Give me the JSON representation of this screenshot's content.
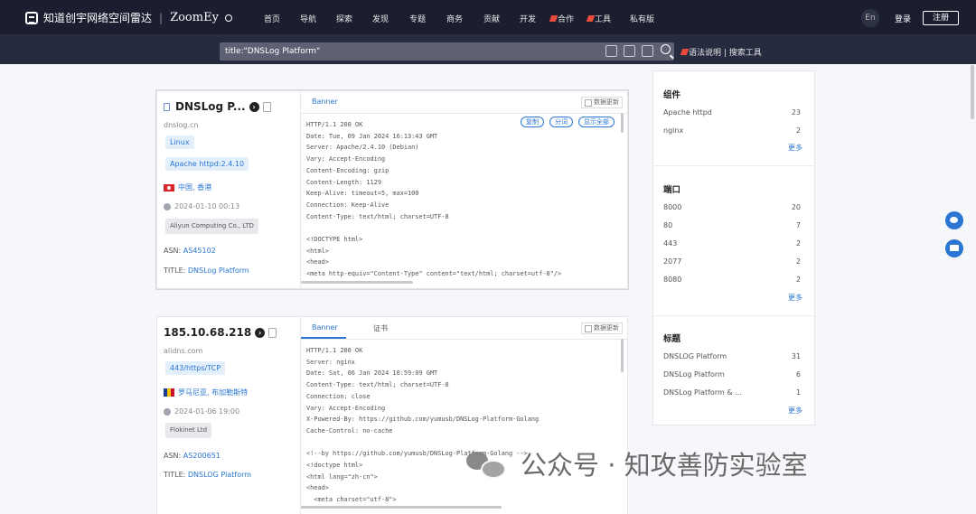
{
  "topnav": {
    "logo_text": "知道创宇网络空间雷达",
    "brand": "ZoomEy",
    "items": [
      "首页",
      "导航",
      "探索",
      "发现",
      "专题",
      "商务",
      "贡献",
      "开发",
      "合作",
      "工具",
      "私有版"
    ],
    "lang": "En",
    "login": "登录",
    "register": "注册"
  },
  "search": {
    "query": "title:\"DNSLog Platform\"",
    "syntax_link": "语法说明 | 搜索工具",
    "icons": [
      "ip-icon",
      "image-search-icon",
      "scan-icon",
      "search-icon"
    ]
  },
  "results": [
    {
      "host": "DNSLog P...",
      "domain": "dnslog.cn",
      "tags": [
        "Linux",
        "Apache httpd:2.4.10"
      ],
      "geo": "中国, 香港",
      "time": "2024-01-10 00:13",
      "org": "Aliyun Computing Co., LTD",
      "asn_label": "ASN:",
      "asn": "AS45102",
      "title_label": "TITLE:",
      "title": "DNSLog Platform",
      "tabs": [
        "Banner"
      ],
      "refresh": "数据更新",
      "actions": [
        "复制",
        "分词",
        "显示全部"
      ],
      "banner": "HTTP/1.1 200 OK\nDate: Tue, 09 Jan 2024 16:13:43 GMT\nServer: Apache/2.4.10 (Debian)\nVary: Accept-Encoding\nContent-Encoding: gzip\nContent-Length: 1129\nKeep-Alive: timeout=5, max=100\nConnection: Keep-Alive\nContent-Type: text/html; charset=UTF-8\n\n<!DOCTYPE html>\n<html>\n<head>\n<meta http-equiv=\"Content-Type\" content=\"text/html; charset=utf-8\"/>"
    },
    {
      "host": "185.10.68.218",
      "domain": "alidns.com",
      "tags": [
        "443/https/TCP"
      ],
      "geo": "罗马尼亚, 布加勒斯特",
      "time": "2024-01-06 19:00",
      "org": "Flokinet Ltd",
      "asn_label": "ASN:",
      "asn": "AS200651",
      "title_label": "TITLE:",
      "title": "DNSLOG Platform",
      "tabs": [
        "Banner",
        "证书"
      ],
      "refresh": "数据更新",
      "banner": "HTTP/1.1 200 OK\nServer: nginx\nDate: Sat, 06 Jan 2024 10:59:09 GMT\nContent-Type: text/html; charset=UTF-8\nConnection: close\nVary: Accept-Encoding\nX-Powered-By: https://github.com/yumusb/DNSLog-Platform-Golang\nCache-Control: no-cache\n\n<!--by https://github.com/yumusb/DNSLog-Platform-Golang -->\n<!doctype html>\n<html lang=\"zh-cn\">\n<head>\n  <meta charset=\"utf-8\">"
    }
  ],
  "sidebar": {
    "sections": [
      {
        "title": "组件",
        "rows": [
          [
            "Apache httpd",
            "23"
          ],
          [
            "nginx",
            "2"
          ]
        ],
        "more": "更多"
      },
      {
        "title": "端口",
        "rows": [
          [
            "8000",
            "20"
          ],
          [
            "80",
            "7"
          ],
          [
            "443",
            "2"
          ],
          [
            "2077",
            "2"
          ],
          [
            "8080",
            "2"
          ]
        ],
        "more": "更多"
      },
      {
        "title": "标题",
        "rows": [
          [
            "DNSLOG Platform",
            "31"
          ],
          [
            "DNSLog Platform",
            "6"
          ],
          [
            "DNSLog Platform & ...",
            "1"
          ]
        ],
        "more": "更多"
      }
    ]
  },
  "watermark": "公众号 · 知攻善防实验室",
  "colors": {
    "nav_bg": "#1b1e2f",
    "search_strip": "#262b40",
    "accent": "#2a76d2",
    "page_bg": "#f5f7fa"
  }
}
